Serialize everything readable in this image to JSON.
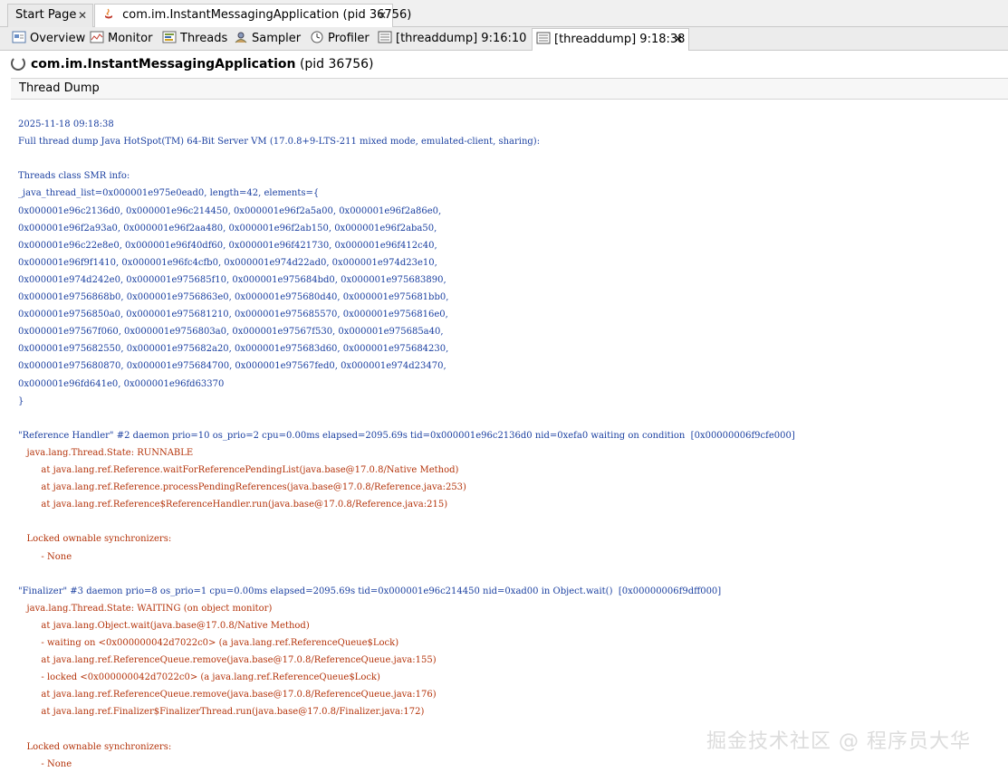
{
  "top_tabs": [
    {
      "label": "Start Page"
    },
    {
      "label": "com.im.InstantMessagingApplication (pid 36756)"
    }
  ],
  "view_tabs": [
    {
      "label": "Overview",
      "icon": "overview-icon"
    },
    {
      "label": "Monitor",
      "icon": "monitor-icon"
    },
    {
      "label": "Threads",
      "icon": "threads-icon"
    },
    {
      "label": "Sampler",
      "icon": "sampler-icon"
    },
    {
      "label": "Profiler",
      "icon": "profiler-icon"
    },
    {
      "label": "[threaddump] 9:16:10",
      "icon": "threaddump-icon"
    },
    {
      "label": "[threaddump] 9:18:38",
      "icon": "threaddump-icon"
    }
  ],
  "app": {
    "name": "com.im.InstantMessagingApplication",
    "pid": "(pid 36756)"
  },
  "section_title": "Thread Dump",
  "dump_lines": [
    "2025-11-18 09:18:38",
    "Full thread dump Java HotSpot(TM) 64-Bit Server VM (17.0.8+9-LTS-211 mixed mode, emulated-client, sharing):",
    "",
    "Threads class SMR info:",
    "_java_thread_list=0x000001e975e0ead0, length=42, elements={",
    "0x000001e96c2136d0, 0x000001e96c214450, 0x000001e96f2a5a00, 0x000001e96f2a86e0,",
    "0x000001e96f2a93a0, 0x000001e96f2aa480, 0x000001e96f2ab150, 0x000001e96f2aba50,",
    "0x000001e96c22e8e0, 0x000001e96f40df60, 0x000001e96f421730, 0x000001e96f412c40,",
    "0x000001e96f9f1410, 0x000001e96fc4cfb0, 0x000001e974d22ad0, 0x000001e974d23e10,",
    "0x000001e974d242e0, 0x000001e975685f10, 0x000001e975684bd0, 0x000001e975683890,",
    "0x000001e9756868b0, 0x000001e9756863e0, 0x000001e975680d40, 0x000001e975681bb0,",
    "0x000001e9756850a0, 0x000001e975681210, 0x000001e975685570, 0x000001e9756816e0,",
    "0x000001e97567f060, 0x000001e9756803a0, 0x000001e97567f530, 0x000001e975685a40,",
    "0x000001e975682550, 0x000001e975682a20, 0x000001e975683d60, 0x000001e975684230,",
    "0x000001e975680870, 0x000001e975684700, 0x000001e97567fed0, 0x000001e974d23470,",
    "0x000001e96fd641e0, 0x000001e96fd63370",
    "}",
    "",
    "\"Reference Handler\" #2 daemon prio=10 os_prio=2 cpu=0.00ms elapsed=2095.69s tid=0x000001e96c2136d0 nid=0xefa0 waiting on condition  [0x00000006f9cfe000]",
    "   java.lang.Thread.State: RUNNABLE",
    "        at java.lang.ref.Reference.waitForReferencePendingList(java.base@17.0.8/Native Method)",
    "        at java.lang.ref.Reference.processPendingReferences(java.base@17.0.8/Reference.java:253)",
    "        at java.lang.ref.Reference$ReferenceHandler.run(java.base@17.0.8/Reference.java:215)",
    "",
    "   Locked ownable synchronizers:",
    "        - None",
    "",
    "\"Finalizer\" #3 daemon prio=8 os_prio=1 cpu=0.00ms elapsed=2095.69s tid=0x000001e96c214450 nid=0xad00 in Object.wait()  [0x00000006f9dff000]",
    "   java.lang.Thread.State: WAITING (on object monitor)",
    "        at java.lang.Object.wait(java.base@17.0.8/Native Method)",
    "        - waiting on <0x000000042d7022c0> (a java.lang.ref.ReferenceQueue$Lock)",
    "        at java.lang.ref.ReferenceQueue.remove(java.base@17.0.8/ReferenceQueue.java:155)",
    "        - locked <0x000000042d7022c0> (a java.lang.ref.ReferenceQueue$Lock)",
    "        at java.lang.ref.ReferenceQueue.remove(java.base@17.0.8/ReferenceQueue.java:176)",
    "        at java.lang.ref.Finalizer$FinalizerThread.run(java.base@17.0.8/Finalizer.java:172)",
    "",
    "   Locked ownable synchronizers:",
    "        - None"
  ],
  "colors": {
    "dump_blue": "#1a3fa0",
    "dump_red": "#b4330a"
  },
  "watermark": "掘金技术社区 @ 程序员大华"
}
